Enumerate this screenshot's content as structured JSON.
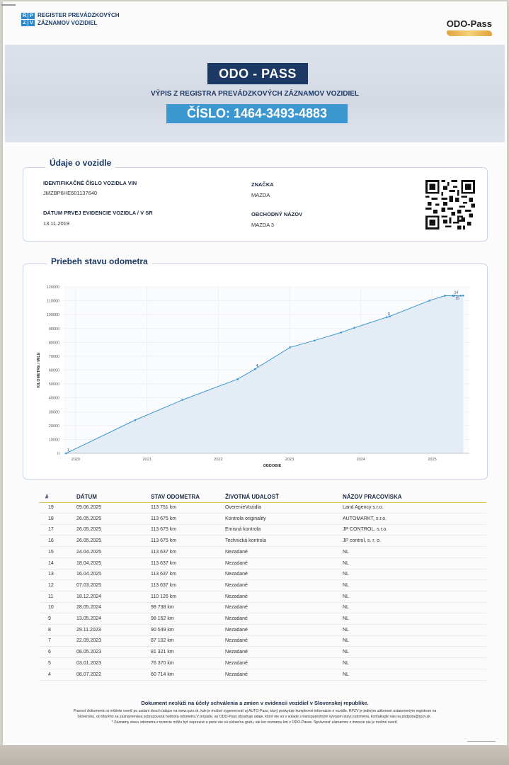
{
  "header": {
    "rpzv_letters": [
      "R",
      "P",
      "Z",
      "V"
    ],
    "rpzv_line1": "REGISTER PREVÁDZKOVÝCH",
    "rpzv_line2": "ZÁZNAMOV VOZIDIEL",
    "odo_logo": "ODO-Pass"
  },
  "banner": {
    "title": "ODO - PASS",
    "subtitle": "VÝPIS Z REGISTRA PREVÁDZKOVÝCH ZÁZNAMOV VOZIDIEL",
    "number": "ČÍSLO: 1464-3493-4883"
  },
  "vehicle": {
    "section_title": "Údaje o vozidle",
    "vin_label": "IDENTIFIKAČNÉ ČÍSLO VOZIDLA VIN",
    "vin_value": "JMZBP6HE601137640",
    "reg_label": "DÁTUM PRVEJ EVIDENCIE VOZIDLA / V SR",
    "reg_value": "13.11.2019",
    "brand_label": "ZNAČKA",
    "brand_value": "MAZDA",
    "model_label": "OBCHODNÝ NÁZOV",
    "model_value": "MAZDA 3"
  },
  "chart_section_title": "Priebeh stavu odometra",
  "chart_data": {
    "type": "area",
    "ylabel": "KILOMETRE / MILE",
    "xlabel": "OBDOBIE",
    "ylim": [
      0,
      120000
    ],
    "yticks": [
      0,
      10000,
      20000,
      30000,
      40000,
      50000,
      60000,
      70000,
      80000,
      90000,
      100000,
      110000,
      120000
    ],
    "xticks": [
      "2020",
      "2021",
      "2022",
      "2023",
      "2024",
      "2025"
    ],
    "xlim": [
      "2019-11-01",
      "2025-07-10"
    ],
    "color": "#3c97d1",
    "fill": "#e4ecf5",
    "points": [
      {
        "date": "2019-11-13",
        "km": 0,
        "label": "1"
      },
      {
        "date": "2020-11-01",
        "km": 24000,
        "label": ""
      },
      {
        "date": "2021-07-01",
        "km": 38500,
        "label": ""
      },
      {
        "date": "2022-04-10",
        "km": 53500,
        "label": ""
      },
      {
        "date": "2022-07-08",
        "km": 60714,
        "label": "4"
      },
      {
        "date": "2023-01-03",
        "km": 76370,
        "label": ""
      },
      {
        "date": "2023-05-08",
        "km": 81321,
        "label": ""
      },
      {
        "date": "2023-09-22",
        "km": 87102,
        "label": ""
      },
      {
        "date": "2023-11-29",
        "km": 90549,
        "label": ""
      },
      {
        "date": "2024-05-13",
        "km": 98162,
        "label": "9"
      },
      {
        "date": "2024-05-28",
        "km": 98738,
        "label": ""
      },
      {
        "date": "2024-12-18",
        "km": 110126,
        "label": ""
      },
      {
        "date": "2025-03-07",
        "km": 113637,
        "label": ""
      },
      {
        "date": "2025-04-16",
        "km": 113637,
        "label": ""
      },
      {
        "date": "2025-04-18",
        "km": 113637,
        "label": "14"
      },
      {
        "date": "2025-04-24",
        "km": 113637,
        "label": "15"
      },
      {
        "date": "2025-05-26",
        "km": 113675,
        "label": ""
      },
      {
        "date": "2025-06-09",
        "km": 113751,
        "label": ""
      }
    ]
  },
  "table": {
    "headers": [
      "#",
      "DÁTUM",
      "STAV ODOMETRA",
      "ŽIVOTNÁ UDALOSŤ",
      "NÁZOV PRACOVISKA"
    ],
    "rows": [
      [
        "19",
        "09.06.2025",
        "113 751 km",
        "OverenieVozidla",
        "Land Agency s.r.o."
      ],
      [
        "18",
        "26.05.2025",
        "113 675 km",
        "Kontrola originality",
        "AUTOMARKT, s.r.o."
      ],
      [
        "17",
        "26.05.2025",
        "113 675 km",
        "Emisná kontrola",
        "JP CONTROL, s.r.o."
      ],
      [
        "16",
        "26.05.2025",
        "113 675 km",
        "Technická kontrola",
        "JP control, s. r. o."
      ],
      [
        "15",
        "24.04.2025",
        "113 637 km",
        "Nezadané",
        "NL"
      ],
      [
        "14",
        "18.04.2025",
        "113 637 km",
        "Nezadané",
        "NL"
      ],
      [
        "13",
        "16.04.2025",
        "113 637 km",
        "Nezadané",
        "NL"
      ],
      [
        "12",
        "07.03.2025",
        "113 637 km",
        "Nezadané",
        "NL"
      ],
      [
        "11",
        "18.12.2024",
        "110 126 km",
        "Nezadané",
        "NL"
      ],
      [
        "10",
        "28.05.2024",
        "98 738 km",
        "Nezadané",
        "NL"
      ],
      [
        "9",
        "13.05.2024",
        "98 162 km",
        "Nezadané",
        "NL"
      ],
      [
        "8",
        "29.11.2023",
        "90 549 km",
        "Nezadané",
        "NL"
      ],
      [
        "7",
        "22.09.2023",
        "87 102 km",
        "Nezadané",
        "NL"
      ],
      [
        "6",
        "08.05.2023",
        "81 321 km",
        "Nezadané",
        "NL"
      ],
      [
        "5",
        "03.01.2023",
        "76 370 km",
        "Nezadané",
        "NL"
      ],
      [
        "4",
        "08.07.2022",
        "60 714 km",
        "Nezadané",
        "NL"
      ]
    ]
  },
  "footer": {
    "bold": "Dokument neslúži na účely schválenia a zmien v evidencii vozidiel v Slovenskej republike.",
    "line1": "Pravosť dokumentu si môžete overiť po zadaní dvoch údajov na www.rpzv.sk, kde je možné vygenerovať aj AUTO-Pass, ktorý poskytuje komplexné informácie o vozidle. RPZV je jediným zákonom ustanoveným registrom na",
    "line2": "Slovensku, do ktorého sa zaznamenáva zobrazovaná hodnota odometra.V prípade, ak ODO-Pass obsahuje údaje, ktoré nie sú v súlade s transparentným vývojom stavu odometra, kontaktujte nás na podpora@rpzv.sk .",
    "line3": "* Záznamy stavu odometra z inzercie môžu byť nepresné a preto nie sú súčasťou grafu, ale len zoznamu km v ODO-Passe. Správnosť záznamov z inzercie nie je možné overiť."
  }
}
